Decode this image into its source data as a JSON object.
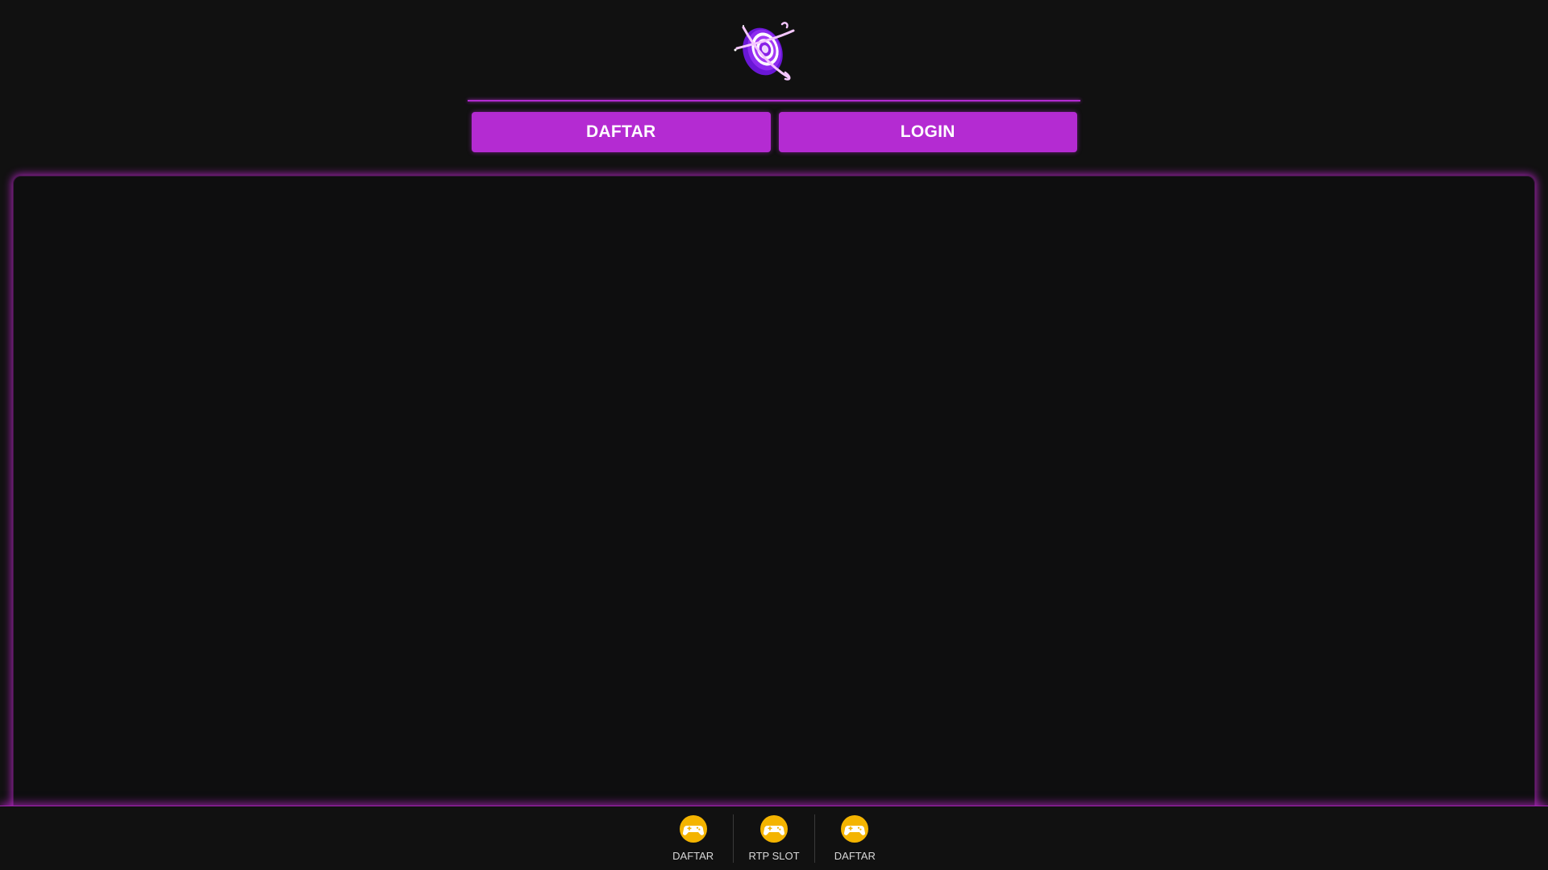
{
  "header": {
    "logo_icon": "galaxy-target-logo-icon",
    "register_label": "DAFTAR",
    "login_label": "LOGIN"
  },
  "colors": {
    "background": "#111111",
    "accent": "#b42bd2",
    "nav_icon": "#f4b400"
  },
  "bottom_nav": {
    "items": [
      {
        "label": "DAFTAR",
        "icon": "gamepad-icon"
      },
      {
        "label": "RTP SLOT",
        "icon": "gamepad-icon"
      },
      {
        "label": "DAFTAR",
        "icon": "gamepad-icon"
      }
    ]
  }
}
